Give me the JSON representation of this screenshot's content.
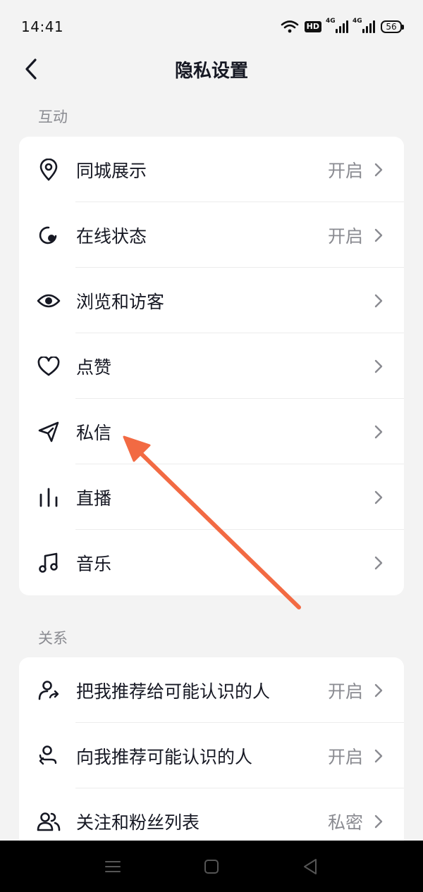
{
  "status": {
    "time": "14:41",
    "hd": "HD",
    "net1": "4G",
    "net2": "4G",
    "battery": "56"
  },
  "header": {
    "title": "隐私设置"
  },
  "sections": [
    {
      "label": "互动",
      "items": [
        {
          "label": "同城展示",
          "value": "开启",
          "icon": "location-pin-icon"
        },
        {
          "label": "在线状态",
          "value": "开启",
          "icon": "online-status-icon"
        },
        {
          "label": "浏览和访客",
          "value": "",
          "icon": "eye-icon"
        },
        {
          "label": "点赞",
          "value": "",
          "icon": "heart-icon"
        },
        {
          "label": "私信",
          "value": "",
          "icon": "send-icon"
        },
        {
          "label": "直播",
          "value": "",
          "icon": "live-bars-icon"
        },
        {
          "label": "音乐",
          "value": "",
          "icon": "music-note-icon"
        }
      ]
    },
    {
      "label": "关系",
      "items": [
        {
          "label": "把我推荐给可能认识的人",
          "value": "开启",
          "icon": "user-share-icon"
        },
        {
          "label": "向我推荐可能认识的人",
          "value": "开启",
          "icon": "user-recommend-icon"
        },
        {
          "label": "关注和粉丝列表",
          "value": "私密",
          "icon": "users-icon"
        }
      ]
    }
  ],
  "annotation": {
    "color": "#f26a43",
    "points_to": "私信"
  },
  "colors": {
    "background": "#f3f3f3",
    "card": "#ffffff",
    "text_primary": "#161823",
    "text_secondary": "#8a8b91"
  }
}
